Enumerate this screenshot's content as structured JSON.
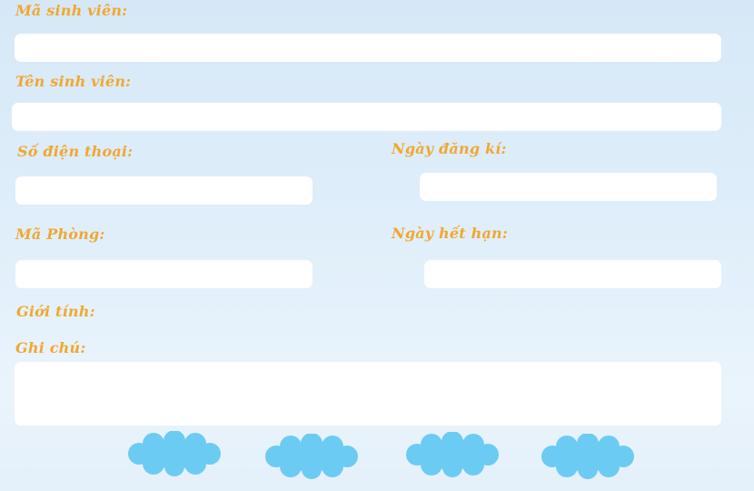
{
  "form": {
    "student_id_label": "Mã sinh viên:",
    "student_name_label": "Tên sinh viên:",
    "phone_label": "Số điện thoại:",
    "register_date_label": "Ngày đăng kí:",
    "room_id_label": "Mã Phòng:",
    "expiry_date_label": "Ngày hết hạn:",
    "gender_label": "Giới tính:",
    "note_label": "Ghi chú:"
  },
  "colors": {
    "label": "#f0a830",
    "cloud": "#6ccbf2",
    "field": "#ffffff"
  }
}
